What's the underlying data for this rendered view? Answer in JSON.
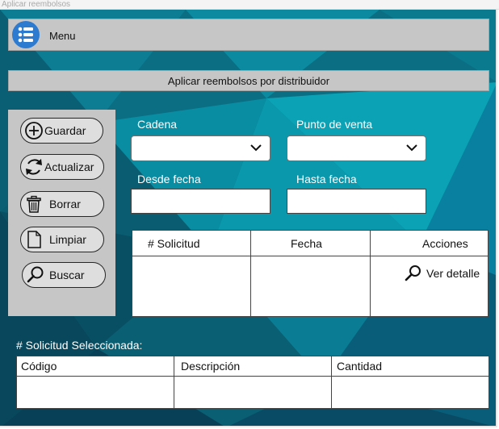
{
  "window": {
    "title": "Aplicar reembolsos"
  },
  "menu": {
    "icon": "list-menu-icon",
    "label": "Menu"
  },
  "banner": {
    "title": "Aplicar reembolsos por distribuidor"
  },
  "sidebar": {
    "buttons": [
      {
        "label": "Guardar",
        "icon": "add-circle-icon"
      },
      {
        "label": "Actualizar",
        "icon": "refresh-icon"
      },
      {
        "label": "Borrar",
        "icon": "trash-icon"
      },
      {
        "label": "Limpiar",
        "icon": "document-icon"
      },
      {
        "label": "Buscar",
        "icon": "search-icon"
      }
    ]
  },
  "filters": {
    "cadena": {
      "label": "Cadena",
      "value": ""
    },
    "punto_venta": {
      "label": "Punto de venta",
      "value": ""
    },
    "desde_fecha": {
      "label": "Desde fecha",
      "value": ""
    },
    "hasta_fecha": {
      "label": "Hasta fecha",
      "value": ""
    }
  },
  "requests_table": {
    "columns": [
      "# Solicitud",
      "Fecha",
      "Acciones"
    ],
    "rows": [
      {
        "solicitud": "",
        "fecha": "",
        "accion": "Ver detalle",
        "accion_icon": "search-icon"
      }
    ]
  },
  "selected": {
    "label": "# Solicitud Seleccionada:",
    "columns": [
      "Código",
      "Descripción",
      "Cantidad"
    ],
    "rows": [
      {
        "codigo": "",
        "descripcion": "",
        "cantidad": ""
      }
    ]
  },
  "colors": {
    "background": "#0a6f83",
    "panel": "#c6c6c6",
    "menu_icon": "#2d7bd0"
  }
}
